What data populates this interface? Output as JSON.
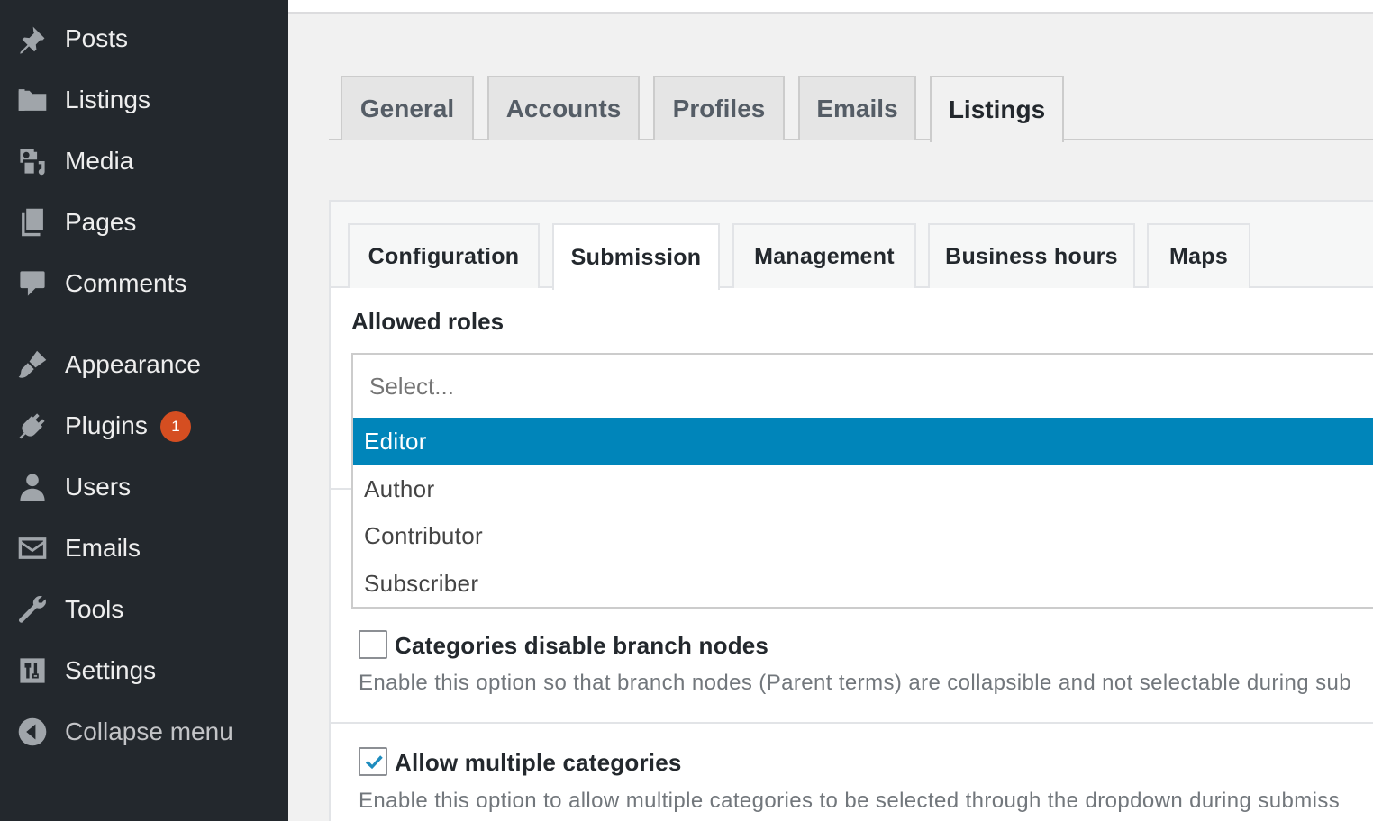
{
  "sidebar": {
    "items": [
      {
        "label": "Posts",
        "icon": "pushpin-icon"
      },
      {
        "label": "Listings",
        "icon": "folder-icon"
      },
      {
        "label": "Media",
        "icon": "media-icon"
      },
      {
        "label": "Pages",
        "icon": "pages-icon"
      },
      {
        "label": "Comments",
        "icon": "comment-icon"
      },
      {
        "label": "Appearance",
        "icon": "paintbrush-icon"
      },
      {
        "label": "Plugins",
        "icon": "plug-icon",
        "badge": "1"
      },
      {
        "label": "Users",
        "icon": "user-icon"
      },
      {
        "label": "Emails",
        "icon": "envelope-icon"
      },
      {
        "label": "Tools",
        "icon": "wrench-icon"
      },
      {
        "label": "Settings",
        "icon": "settings-icon"
      },
      {
        "label": "Collapse menu",
        "icon": "collapse-arrow-icon"
      }
    ]
  },
  "tabs": [
    "General",
    "Accounts",
    "Profiles",
    "Emails",
    "Listings"
  ],
  "active_tab": "Listings",
  "subtabs": [
    "Configuration",
    "Submission",
    "Management",
    "Business hours",
    "Maps"
  ],
  "active_subtab": "Submission",
  "allowed_roles": {
    "label": "Allowed roles",
    "placeholder": "Select...",
    "options": [
      "Editor",
      "Author",
      "Contributor",
      "Subscriber"
    ],
    "highlighted": "Editor"
  },
  "options": [
    {
      "label": "Categories disable branch nodes",
      "description": "Enable this option so that branch nodes (Parent terms) are collapsible and not selectable during sub",
      "checked": false
    },
    {
      "label": "Allow multiple categories",
      "description": "Enable this option to allow multiple categories to be selected through the dropdown during submiss",
      "checked": true
    }
  ],
  "colors": {
    "sidebar_bg": "#23282d",
    "highlight": "#0085ba",
    "badge": "#d54e21",
    "checkmark": "#1e8cbe"
  }
}
